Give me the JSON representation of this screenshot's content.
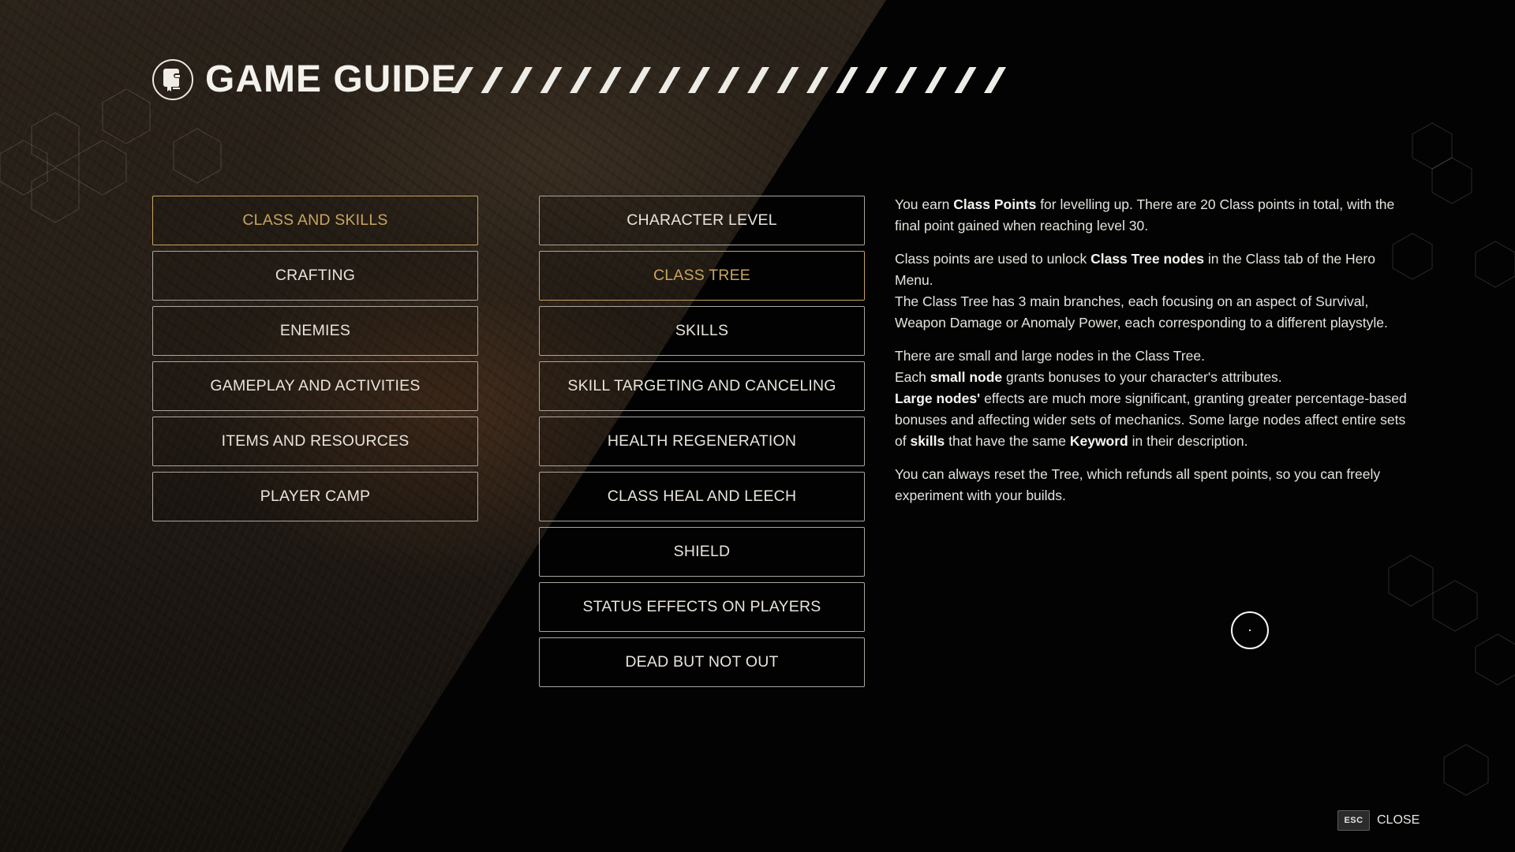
{
  "header": {
    "title": "GAME GUIDE",
    "icon": "guide-book-icon"
  },
  "categories": [
    {
      "label": "CLASS AND SKILLS",
      "active": true
    },
    {
      "label": "CRAFTING",
      "active": false
    },
    {
      "label": "ENEMIES",
      "active": false
    },
    {
      "label": "GAMEPLAY AND ACTIVITIES",
      "active": false
    },
    {
      "label": "ITEMS AND RESOURCES",
      "active": false
    },
    {
      "label": "PLAYER CAMP",
      "active": false
    }
  ],
  "topics": [
    {
      "label": "CHARACTER LEVEL",
      "active": false
    },
    {
      "label": "CLASS TREE",
      "active": true
    },
    {
      "label": "SKILLS",
      "active": false
    },
    {
      "label": "SKILL TARGETING AND CANCELING",
      "active": false
    },
    {
      "label": "HEALTH REGENERATION",
      "active": false
    },
    {
      "label": "CLASS HEAL AND LEECH",
      "active": false
    },
    {
      "label": "SHIELD",
      "active": false
    },
    {
      "label": "STATUS EFFECTS ON PLAYERS",
      "active": false
    },
    {
      "label": "DEAD BUT NOT OUT",
      "active": false
    }
  ],
  "content": {
    "paragraphs": [
      [
        {
          "text": "You earn ",
          "bold": false
        },
        {
          "text": "Class Points",
          "bold": true
        },
        {
          "text": " for levelling up. There are 20 Class points in total, with the final point gained when reaching level 30.",
          "bold": false
        }
      ],
      [
        {
          "text": "Class points are used to unlock ",
          "bold": false
        },
        {
          "text": "Class Tree nodes",
          "bold": true
        },
        {
          "text": " in the Class tab of the Hero Menu.",
          "bold": false
        },
        {
          "br": true
        },
        {
          "text": "The Class Tree has 3 main branches, each focusing on an aspect of Survival, Weapon Damage or Anomaly Power, each corresponding to a different playstyle.",
          "bold": false
        }
      ],
      [
        {
          "text": "There are small and large nodes in the Class Tree.",
          "bold": false
        },
        {
          "br": true
        },
        {
          "text": "Each ",
          "bold": false
        },
        {
          "text": "small node",
          "bold": true
        },
        {
          "text": " grants bonuses to your character's attributes.",
          "bold": false
        },
        {
          "br": true
        },
        {
          "text": "Large nodes'",
          "bold": true
        },
        {
          "text": " effects are much more significant, granting greater percentage-based bonuses and affecting wider sets of mechanics. Some large nodes affect entire sets of ",
          "bold": false
        },
        {
          "text": "skills",
          "bold": true
        },
        {
          "text": " that have the same ",
          "bold": false
        },
        {
          "text": "Keyword",
          "bold": true
        },
        {
          "text": " in their description.",
          "bold": false
        }
      ],
      [
        {
          "text": "You can always reset the Tree, which refunds all spent points, so you can freely experiment with your builds.",
          "bold": false
        }
      ]
    ]
  },
  "footer": {
    "key": "ESC",
    "label": "CLOSE"
  },
  "colors": {
    "accent_gold": "#c9a55e",
    "button_border": "#a9a6a0",
    "text": "#e6e3dd"
  }
}
